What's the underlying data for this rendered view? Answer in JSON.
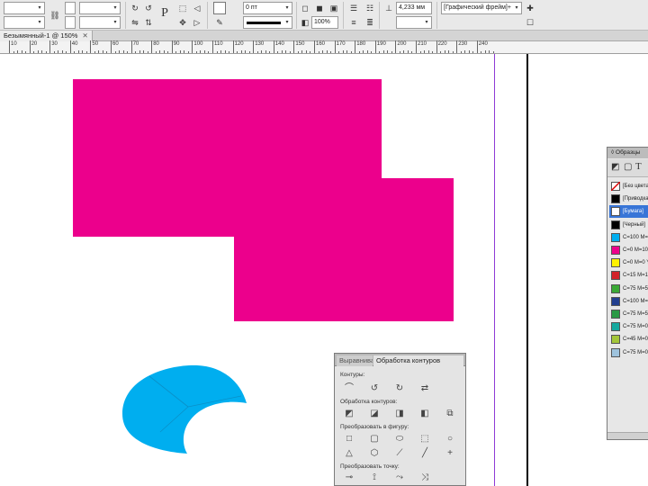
{
  "control_panel": {
    "stroke_weight": "0 пт",
    "zoom_percent": "100%",
    "width_value": "4,233 мм",
    "frame_style": "[Графический фрейм]+"
  },
  "document_tab": {
    "title": "Безымянный-1 @ 150%",
    "close_glyph": "✕"
  },
  "ruler": {
    "labels": [
      "10",
      "20",
      "30",
      "40",
      "50",
      "60",
      "70",
      "80",
      "90",
      "100",
      "110",
      "120",
      "130",
      "140",
      "150",
      "160",
      "170",
      "180",
      "190",
      "200",
      "210",
      "220",
      "230",
      "240"
    ]
  },
  "canvas": {
    "magenta_color": "#ec008c",
    "cyan_color": "#00aeef",
    "guide_color": "#8f3ad6"
  },
  "pathfinder": {
    "tabs": [
      "Выравнивание",
      "Обработка контуров"
    ],
    "sections": [
      "Контуры:",
      "Обработка контуров:",
      "Преобразовать в фигуру:",
      "Преобразовать точку:"
    ]
  },
  "swatches": {
    "title": "Образцы",
    "items": [
      {
        "label": "[Без цвета]",
        "color": "#ffffff",
        "none": true
      },
      {
        "label": "[Приводка]",
        "color": "#000000"
      },
      {
        "label": "[Бумага]",
        "color": "#ffffff",
        "selected": true
      },
      {
        "label": "[Черный]",
        "color": "#000000"
      },
      {
        "label": "C=100 M=0 Y=0 K=0",
        "color": "#00aeef"
      },
      {
        "label": "C=0 M=100 Y=0 K=0",
        "color": "#ec008c"
      },
      {
        "label": "C=0 M=0 Y=100 K=0",
        "color": "#fff200"
      },
      {
        "label": "C=15 M=100 Y=100 K=0",
        "color": "#d2232a"
      },
      {
        "label": "C=75 M=5 Y=100 K=0",
        "color": "#3aa935"
      },
      {
        "label": "C=100 M=90 Y=10 K=0",
        "color": "#223f8f"
      },
      {
        "label": "C=75 M=5 Y=100 K=0",
        "color": "#2b9a45"
      },
      {
        "label": "C=75 M=0 Y=30 K=0",
        "color": "#15a89e"
      },
      {
        "label": "C=45 M=0 Y=100 K=0",
        "color": "#a3c639"
      },
      {
        "label": "C=75 M=0 Y=0 K=0",
        "color": "#9ec3dd"
      }
    ]
  }
}
